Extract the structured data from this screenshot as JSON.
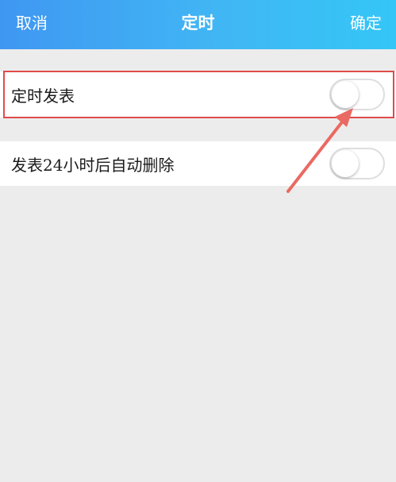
{
  "nav": {
    "cancel_label": "取消",
    "title": "定时",
    "confirm_label": "确定",
    "gradient_start": "#3f97f2",
    "gradient_end": "#34c6f6"
  },
  "settings": {
    "items": [
      {
        "label": "定时发表",
        "enabled": false
      },
      {
        "label": "发表24小时后自动删除",
        "enabled": false
      }
    ]
  },
  "annotation": {
    "color": "#e04b4b",
    "highlighted_item": "定时发表"
  }
}
